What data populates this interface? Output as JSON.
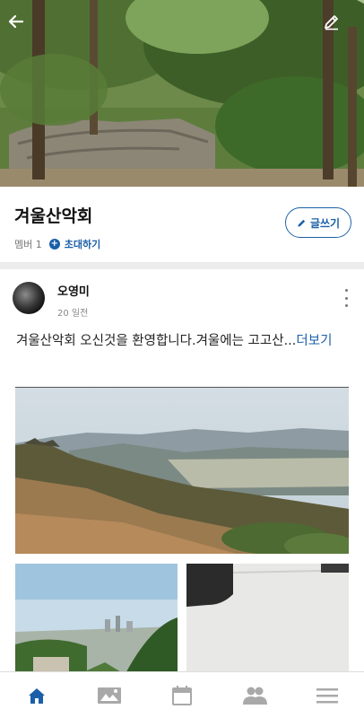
{
  "group": {
    "name": "겨울산악회",
    "member_label": "멤버 1",
    "invite_label": "초대하기",
    "write_label": "글쓰기"
  },
  "post": {
    "author": "오영미",
    "time": "20 일전",
    "text": "겨울산악회 오신것을 환영합니다.겨울에는 고고산...",
    "more_label": "더보기"
  },
  "icons": {
    "back": "back-arrow-icon",
    "edit": "pencil-icon",
    "more": "more-vertical-icon",
    "nav": [
      "home-icon",
      "photo-icon",
      "calendar-icon",
      "members-icon",
      "menu-icon"
    ]
  },
  "colors": {
    "accent": "#1a5fa8",
    "nav_active": "#1a5fa8",
    "nav_inactive": "#a9a9a9"
  },
  "bottom_nav": {
    "active_index": 0
  }
}
